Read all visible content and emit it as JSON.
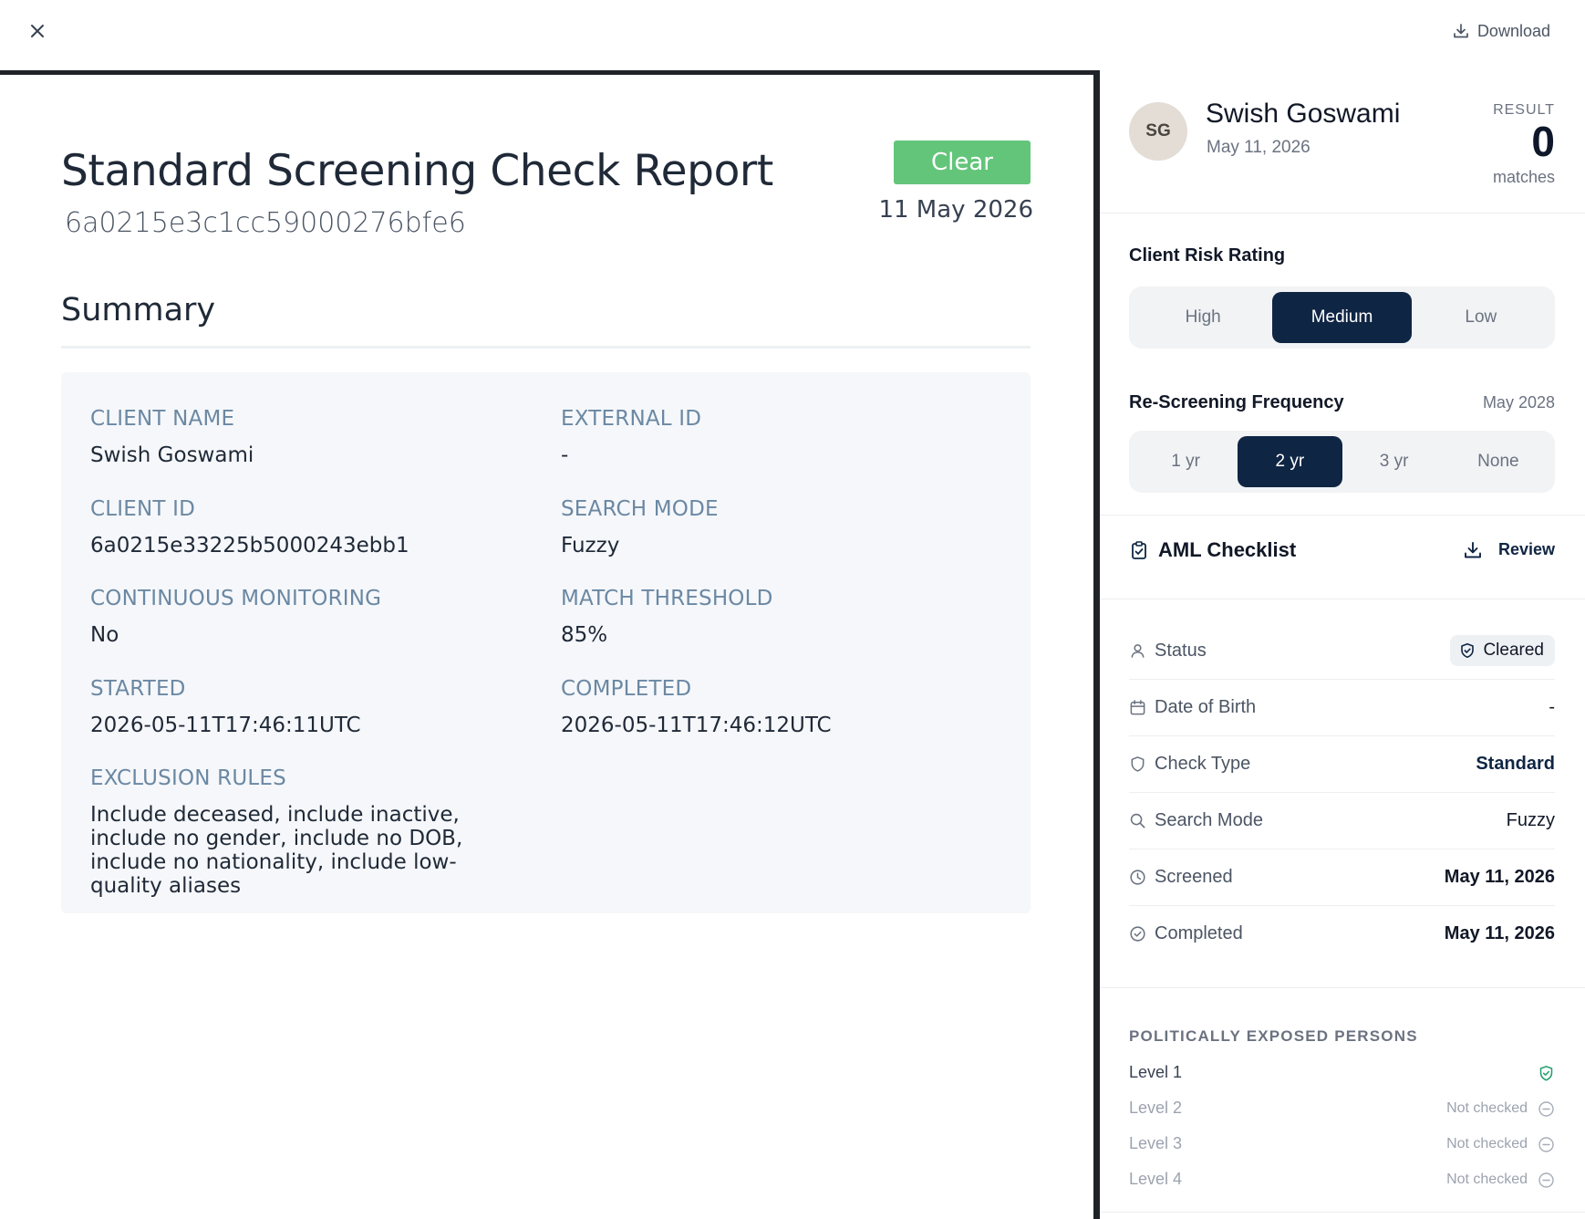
{
  "topbar": {
    "download_label": "Download"
  },
  "report": {
    "title": "Standard Screening Check Report",
    "id": "6a0215e3c1cc59000276bfe6",
    "status_badge": "Clear",
    "status_color": "#63c57a",
    "date": "11 May 2026",
    "summary_title": "Summary",
    "fields": [
      {
        "label": "CLIENT NAME",
        "value": "Swish Goswami"
      },
      {
        "label": "EXTERNAL ID",
        "value": "-"
      },
      {
        "label": "CLIENT ID",
        "value": "6a0215e33225b5000243ebb1"
      },
      {
        "label": "SEARCH MODE",
        "value": "Fuzzy"
      },
      {
        "label": "CONTINUOUS MONITORING",
        "value": "No"
      },
      {
        "label": "MATCH THRESHOLD",
        "value": "85%"
      },
      {
        "label": "STARTED",
        "value": "2026-05-11T17:46:11UTC"
      },
      {
        "label": "COMPLETED",
        "value": "2026-05-11T17:46:12UTC"
      },
      {
        "label": "EXCLUSION RULES",
        "value": "Include deceased, include inactive, include no gender, include no DOB, include no nationality, include low-quality aliases"
      }
    ]
  },
  "profile": {
    "initials": "SG",
    "name": "Swish Goswami",
    "date": "May 11, 2026",
    "result_label": "RESULT",
    "result_value": "0",
    "result_unit": "matches"
  },
  "risk": {
    "label": "Client Risk Rating",
    "options": [
      "High",
      "Medium",
      "Low"
    ],
    "selected": "Medium"
  },
  "rescreen": {
    "label": "Re-Screening Frequency",
    "next_date": "May 2028",
    "options": [
      "1 yr",
      "2 yr",
      "3 yr",
      "None"
    ],
    "selected": "2 yr"
  },
  "aml": {
    "title": "AML Checklist",
    "review_label": "Review"
  },
  "details": [
    {
      "icon": "user-icon",
      "label": "Status",
      "value": "Cleared"
    },
    {
      "icon": "calendar-icon",
      "label": "Date of Birth",
      "value": "-"
    },
    {
      "icon": "shield-icon",
      "label": "Check Type",
      "value": "Standard"
    },
    {
      "icon": "search-icon",
      "label": "Search Mode",
      "value": "Fuzzy"
    },
    {
      "icon": "clock-icon",
      "label": "Screened",
      "value": "May 11, 2026"
    },
    {
      "icon": "check-circle-icon",
      "label": "Completed",
      "value": "May 11, 2026"
    }
  ],
  "pep": {
    "title": "POLITICALLY EXPOSED PERSONS",
    "levels": [
      {
        "label": "Level 1",
        "status": "",
        "icon": "shield-check-icon"
      },
      {
        "label": "Level 2",
        "status": "Not checked",
        "icon": "minus-circle-icon"
      },
      {
        "label": "Level 3",
        "status": "Not checked",
        "icon": "minus-circle-icon"
      },
      {
        "label": "Level 4",
        "status": "Not checked",
        "icon": "minus-circle-icon"
      }
    ]
  },
  "colors": {
    "navy": "#0f2544",
    "label_blue": "#6b88a3",
    "cleared_green": "#22a06b"
  }
}
